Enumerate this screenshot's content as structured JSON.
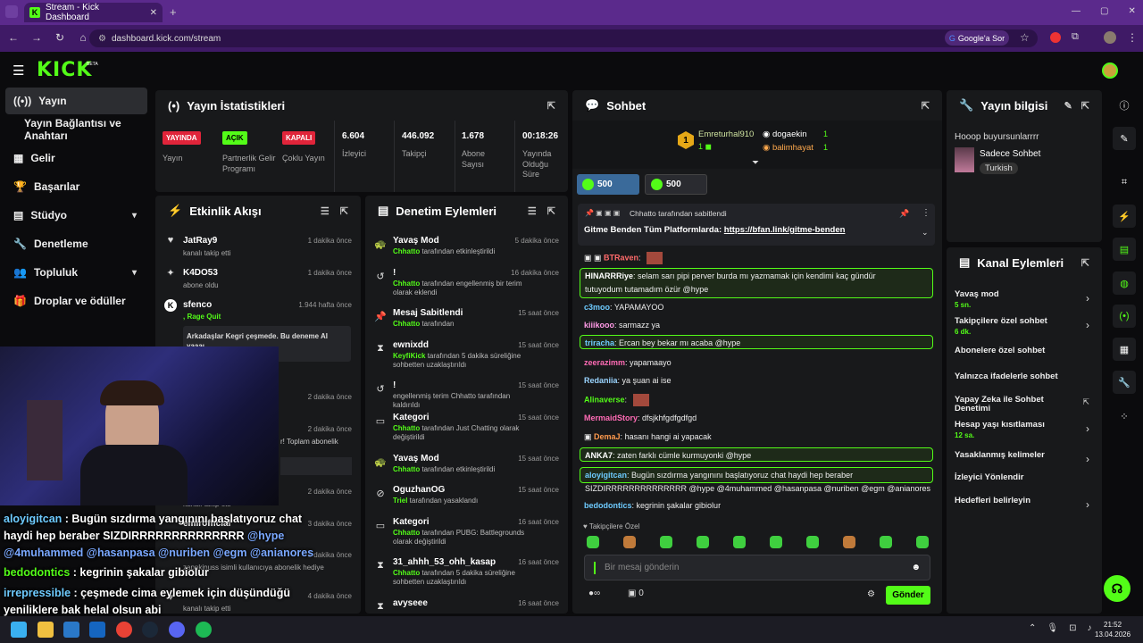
{
  "browser": {
    "tab_title": "Stream - Kick Dashboard",
    "url": "dashboard.kick.com/stream",
    "google_btn": "Google'a Sor"
  },
  "app": {
    "logo": "KICK",
    "beta": "BETA"
  },
  "sidebar": {
    "items": [
      {
        "label": "Yayın",
        "icon": "broadcast-icon"
      },
      {
        "label": "Yayın Bağlantısı ve Anahtarı"
      },
      {
        "label": "Gelir",
        "icon": "chart-icon"
      },
      {
        "label": "Başarılar",
        "icon": "trophy-icon"
      },
      {
        "label": "Stüdyo",
        "icon": "studio-icon"
      },
      {
        "label": "Denetleme",
        "icon": "wrench-icon"
      },
      {
        "label": "Topluluk",
        "icon": "community-icon"
      },
      {
        "label": "Droplar ve ödüller",
        "icon": "gift-icon"
      }
    ]
  },
  "stats": {
    "title": "Yayın İstatistikleri",
    "cols": [
      {
        "badge": "YAYINDA",
        "label": "Yayın"
      },
      {
        "badge": "AÇIK",
        "label": "Partnerlik Gelir Programı"
      },
      {
        "badge": "KAPALI",
        "label": "Çoklu Yayın"
      },
      {
        "value": "6.604",
        "label": "İzleyici"
      },
      {
        "value": "446.092",
        "label": "Takipçi"
      },
      {
        "value": "1.678",
        "label": "Abone Sayısı"
      },
      {
        "value": "00:18:26",
        "label": "Yayında Olduğu Süre"
      }
    ]
  },
  "activity": {
    "title": "Etkinlik Akışı",
    "items": [
      {
        "name": "JatRay9",
        "sub": "kanalı takip etti",
        "time": "1 dakika önce"
      },
      {
        "name": "K4DO53",
        "sub": "abone oldu",
        "time": "1 dakika önce"
      },
      {
        "name": "sfenco",
        "sub": ", Rage Quit",
        "time": "1.944 hafta önce",
        "msg": "Arkadaşlar Kegri çeşmede. Bu deneme AI",
        "msg2": "yaaaı"
      },
      {
        "time": "2 dakika önce"
      },
      {
        "time": "2 dakika önce",
        "sub": "r! Toplam abonelik"
      },
      {
        "time": "2 dakika önce",
        "sub": "kanalı takip etti"
      },
      {
        "time": "3 dakika önce",
        "name": "emirofficial"
      },
      {
        "time": "3 dakika önce",
        "sub": "zappkinuss isimli kullanıcıya abonelik hediye"
      },
      {
        "time": "4 dakika önce",
        "sub": "kanalı takip etti"
      }
    ]
  },
  "moderation": {
    "title": "Denetim Eylemleri",
    "items": [
      {
        "name": "Yavaş Mod",
        "sub_g": "Chhatto",
        "sub": " tarafından etkinleştirildi",
        "time": "5 dakika önce"
      },
      {
        "name": "!",
        "sub_g": "Chhatto",
        "sub": " tarafından engellenmiş bir terim olarak eklendi",
        "time": "16 dakika önce"
      },
      {
        "name": "Mesaj Sabitlendi",
        "sub_g": "Chhatto",
        "sub": " tarafından",
        "time": "15 saat önce"
      },
      {
        "name": "ewnixdd",
        "sub_g": "KeyfiKick",
        "sub": " tarafından 5 dakika süreliğine sohbetten uzaklaştırıldı",
        "time": "15 saat önce"
      },
      {
        "name": "!",
        "sub": "engellenmiş terim Chhatto tarafından kaldırıldı",
        "time": "15 saat önce"
      },
      {
        "name": "Kategori",
        "sub_g": "Chhatto",
        "sub": " tarafından Just Chatting olarak değiştirildi",
        "time": "15 saat önce"
      },
      {
        "name": "Yavaş Mod",
        "sub_g": "Chhatto",
        "sub": " tarafından etkinleştirildi",
        "time": "15 saat önce"
      },
      {
        "name": "OguzhanOG",
        "sub_g": "Triel",
        "sub": " tarafından yasaklandı",
        "time": "15 saat önce"
      },
      {
        "name": "Kategori",
        "sub_g": "Chhatto",
        "sub": " tarafından PUBG: Battlegrounds olarak değiştirildi",
        "time": "16 saat önce"
      },
      {
        "name": "31_ahhh_53_ohh_kasap",
        "sub_g": "Chhatto",
        "sub": " tarafından 5 dakika süreliğine sohbetten uzaklaştırıldı",
        "time": "16 saat önce"
      },
      {
        "name": "avyseee",
        "time": "16 saat önce"
      }
    ]
  },
  "chat": {
    "title": "Sohbet",
    "top": [
      {
        "name": "Emreturhal910",
        "rank": "1"
      },
      {
        "name": "dogaekin",
        "val": "1"
      },
      {
        "name": "balimhayat",
        "val": "1"
      }
    ],
    "pills": [
      "500",
      "500"
    ],
    "pinned_by": "Chhatto tarafından sabitlendi",
    "pinned_text": "Gitme Benden Tüm Platformlarda: ",
    "pinned_link": "https://bfan.link/gitme-benden",
    "messages": [
      {
        "user": "BTRaven",
        "text": "",
        "color": "#ff6b6b"
      },
      {
        "user": "HINARRRiye",
        "text": "selam sarı pipi perver burda mı    yazmamak için kendimi kaç gündür",
        "text2": "tutuyodum tutamadım özür      @hype",
        "color": "#fff",
        "hl": true
      },
      {
        "user": "c3moo",
        "text": "YAPAMAYOO",
        "color": "#6ecbff"
      },
      {
        "user": "kiiikooo",
        "text": "sarmazz ya",
        "color": "#ff9ae6"
      },
      {
        "user": "trirachа",
        "text": "Ercan bey bekar mı acaba @hype",
        "color": "#6ecbff",
        "hl": true
      },
      {
        "user": "zeerazimm",
        "text": "yapamaayo",
        "color": "#ff6bb5"
      },
      {
        "user": "Redaniia",
        "text": "ya şuan ai ise",
        "color": "#9ad4ff"
      },
      {
        "user": "Alinaverse",
        "text": "",
        "color": "#53fc18"
      },
      {
        "user": "MermaidStory",
        "text": "dfsjkhfgdfgdfgd",
        "color": "#ff6bb5"
      },
      {
        "user": "DemaJ",
        "text": "hasanı hangi ai yapacak",
        "color": "#ff9a4d"
      },
      {
        "user": "ANKA7",
        "text": "zaten farklı cümle kurmuyonki @hype",
        "color": "#fff",
        "hl": true
      },
      {
        "user": "aloyigitcan",
        "text": "Bugün sızdırma yangınını başlatıyoruz chat haydi hep beraber",
        "text2": "SIZDIRRRRRRRRRRRRRR @hype @4muhammed @hasanpasa @nuriben @egm @anianores",
        "color": "#6ecbff",
        "hl": true
      },
      {
        "user": "bedodontics",
        "text": "kegrinin şakalar gibiolur",
        "color": "#6ecbff"
      }
    ],
    "followers_only": "Takipçilere Özel",
    "input_placeholder": "Bir mesaj gönderin",
    "send": "Gönder",
    "count": "0",
    "infinity": "∞"
  },
  "info": {
    "title": "Yayın bilgisi",
    "stream_title": "Hooop buyursunlarrrr",
    "channel": "Sadece Sohbet",
    "language": "Turkish"
  },
  "actions": {
    "title": "Kanal Eylemleri",
    "items": [
      {
        "label": "Yavaş mod",
        "sub": "5 sn.",
        "type": "chev"
      },
      {
        "label": "Takipçilere özel sohbet",
        "sub": "6 dk.",
        "type": "chev"
      },
      {
        "label": "Abonelere özel sohbet",
        "type": "toggle"
      },
      {
        "label": "Yalnızca ifadelerle sohbet",
        "type": "toggle"
      },
      {
        "label": "Yapay Zeka ile Sohbet Denetimi",
        "type": "ext"
      },
      {
        "label": "Hesap yaşı kısıtlaması",
        "sub": "12 sa.",
        "type": "chev"
      },
      {
        "label": "Yasaklanmış kelimeler",
        "type": "chev"
      },
      {
        "label": "İzleyici Yönlendir",
        "type": "none"
      },
      {
        "label": "Hedefleri belirleyin",
        "type": "chev"
      }
    ]
  },
  "overlay": {
    "lines": [
      {
        "user": "aloyigitcan",
        "text": " : Bugün sızdırma yangınını başlatıyoruz chat"
      },
      {
        "user": "",
        "text": "haydi hep beraber SIZDIRRRRRRRRRRRRRR ",
        "tail": "@hype"
      },
      {
        "user": "",
        "text": "@4muhammed @hasanpasa @nuriben @egm @anianores",
        "blue": true
      },
      {
        "user": "bedodontics",
        "text": " : kegrinin şakalar gibiolur"
      },
      {
        "user": "irrepressible",
        "text": " : çeşmede cima eylemek için düşündüğü"
      },
      {
        "user": "",
        "text": "yeniliklere bak helal olsun abi"
      }
    ]
  },
  "taskbar": {
    "time": "21:52",
    "date": "13.04.2026"
  },
  "colors": {
    "accent": "#53fc18",
    "panel": "#18191b",
    "bg": "#0b0b0d"
  }
}
